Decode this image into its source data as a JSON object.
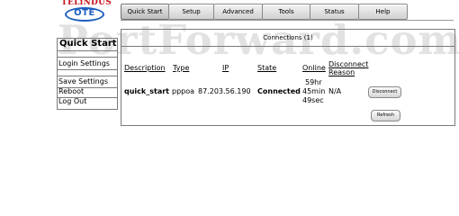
{
  "brand": {
    "top": "TELiNDUS",
    "oval": "OTE"
  },
  "watermark": "PortForward.com",
  "nav": {
    "tabs": [
      {
        "label": "Quick Start",
        "active": true
      },
      {
        "label": "Setup"
      },
      {
        "label": "Advanced"
      },
      {
        "label": "Tools"
      },
      {
        "label": "Status"
      },
      {
        "label": "Help"
      }
    ]
  },
  "sidebar": {
    "title": "Quick Start",
    "items": [
      "Login Settings",
      "Save Settings",
      "Reboot",
      "Log Out"
    ]
  },
  "main": {
    "title": "Connections (1)",
    "headers": {
      "description": "Description",
      "type": "Type",
      "ip": "IP",
      "state": "State",
      "online": "Online",
      "disconnect_reason_1": "Disconnect",
      "disconnect_reason_2": "Reason"
    },
    "row": {
      "description": "quick_start",
      "type": "pppoa",
      "ip": "87.203.56.190",
      "state": "Connected",
      "online_1": "59hr",
      "online_2": "45min",
      "online_3": "49sec",
      "reason": "N/A",
      "disconnect_button": "Disconnect"
    },
    "refresh_button": "Refresh"
  }
}
